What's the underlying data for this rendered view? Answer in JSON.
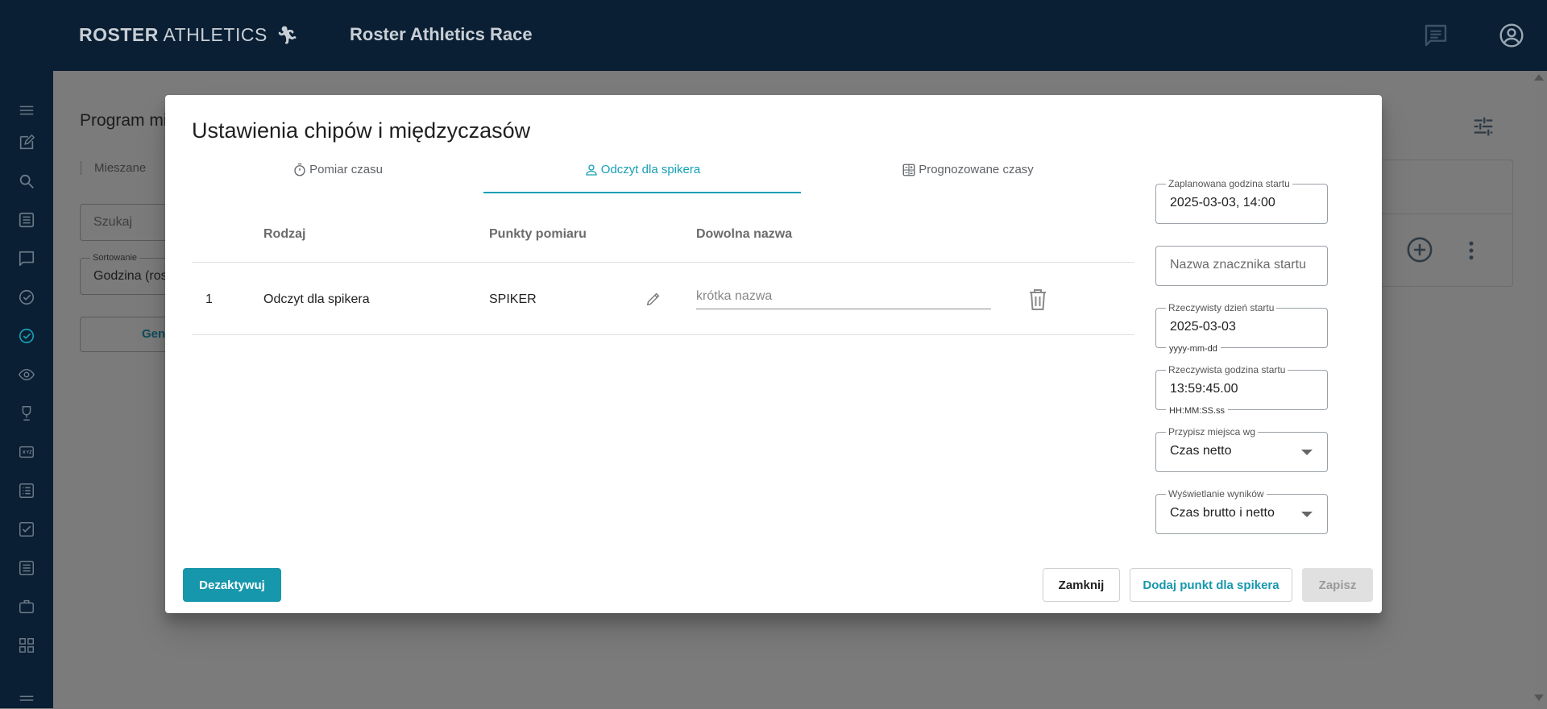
{
  "header": {
    "logo_bold": "ROSTER",
    "logo_light": "ATHLETICS",
    "app_title": "Roster Athletics Race",
    "icons": [
      "chat-icon",
      "account-icon"
    ]
  },
  "sidebar": {
    "icons": [
      "menu-icon",
      "edit-icon",
      "search-icon",
      "list-icon",
      "chat-icon",
      "check-circle-icon",
      "check-circle-active-icon",
      "eye-icon",
      "trophy-icon",
      "xyz-icon",
      "list-detail-icon",
      "checkbox-icon",
      "list-icon",
      "briefcase-icon",
      "grid-icon",
      "menu-icon"
    ],
    "active_color": "#16a0b5",
    "icon_color": "#6b7a88"
  },
  "background_page": {
    "title": "Program mi",
    "tab": "Mieszane",
    "search_placeholder": "Szukaj",
    "sort_label": "Sortowanie",
    "sort_value": "Godzina (rosn",
    "button_text": "Gen"
  },
  "modal": {
    "title": "Ustawienia chipów i międzyczasów",
    "tabs": [
      {
        "label": "Pomiar czasu",
        "icon": "stopwatch-icon"
      },
      {
        "label": "Odczyt dla spikera",
        "icon": "person-icon"
      },
      {
        "label": "Prognozowane czasy",
        "icon": "calculator-icon"
      }
    ],
    "active_tab": 1,
    "table": {
      "headers": [
        "Rodzaj",
        "Punkty pomiaru",
        "Dowolna nazwa"
      ],
      "rows": [
        {
          "index": "1",
          "type": "Odczyt dla spikera",
          "point": "SPIKER",
          "name_placeholder": "krótka nazwa",
          "name_value": ""
        }
      ]
    },
    "fields": {
      "planned_start": {
        "label": "Zaplanowana godzina startu",
        "value": "2025-03-03, 14:00"
      },
      "start_marker": {
        "placeholder": "Nazwa znacznika startu"
      },
      "actual_day": {
        "label": "Rzeczywisty dzień startu",
        "value": "2025-03-03",
        "hint": "yyyy-mm-dd"
      },
      "actual_time": {
        "label": "Rzeczywista godzina startu",
        "value": "13:59:45.00",
        "hint": "HH:MM:SS.ss"
      },
      "assign_places": {
        "label": "Przypisz miejsca wg",
        "value": "Czas netto"
      },
      "results_display": {
        "label": "Wyświetlanie wyników",
        "value": "Czas brutto i netto"
      }
    },
    "buttons": {
      "deactivate": "Dezaktywuj",
      "close": "Zamknij",
      "add_point": "Dodaj punkt dla spikera",
      "save": "Zapisz"
    },
    "accent_color": "#16a0b5"
  }
}
